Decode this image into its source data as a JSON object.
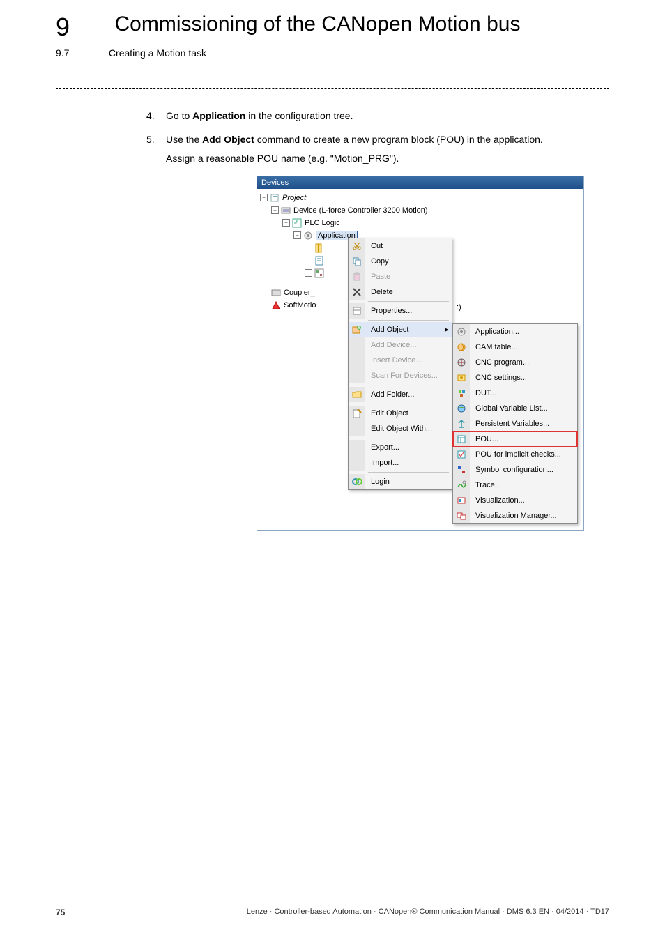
{
  "chapter": {
    "number": "9",
    "title": "Commissioning of the CANopen Motion bus",
    "sub_number": "9.7",
    "sub_title": "Creating a Motion task"
  },
  "steps": {
    "s4": {
      "num": "4.",
      "pre": "Go to ",
      "bold": "Application",
      "post": " in the configuration tree."
    },
    "s5": {
      "num": "5.",
      "pre": "Use the ",
      "bold": "Add Object",
      "post": " command to create a new program block (POU) in the application."
    },
    "s5b": "Assign a reasonable POU name (e.g. \"Motion_PRG\")."
  },
  "devpanel": {
    "title": "Devices",
    "tree": {
      "project": "Project",
      "device": "Device (L-force Controller 3200 Motion)",
      "plc": "PLC Logic",
      "application": "Application",
      "coupler": "Coupler_",
      "softmotion": "SoftMotio",
      "tail": ":)"
    }
  },
  "ctx1": {
    "cut": "Cut",
    "copy": "Copy",
    "paste": "Paste",
    "delete": "Delete",
    "properties": "Properties...",
    "addobject": "Add Object",
    "adddevice": "Add Device...",
    "insertdevice": "Insert Device...",
    "scan": "Scan For Devices...",
    "addfolder": "Add Folder...",
    "editobject": "Edit Object",
    "editobjectwith": "Edit Object With...",
    "export": "Export...",
    "import": "Import...",
    "login": "Login"
  },
  "ctx2": {
    "application": "Application...",
    "camtable": "CAM table...",
    "cncprogram": "CNC program...",
    "cncsettings": "CNC settings...",
    "dut": "DUT...",
    "gvl": "Global Variable List...",
    "persistent": "Persistent Variables...",
    "pou": "POU...",
    "pouimplicit": "POU for implicit checks...",
    "symbolconf": "Symbol configuration...",
    "trace": "Trace...",
    "visualization": "Visualization...",
    "vismanager": "Visualization Manager..."
  },
  "footer": {
    "page": "75",
    "line": "Lenze · Controller-based Automation · CANopen® Communication Manual · DMS 6.3 EN · 04/2014 · TD17"
  }
}
